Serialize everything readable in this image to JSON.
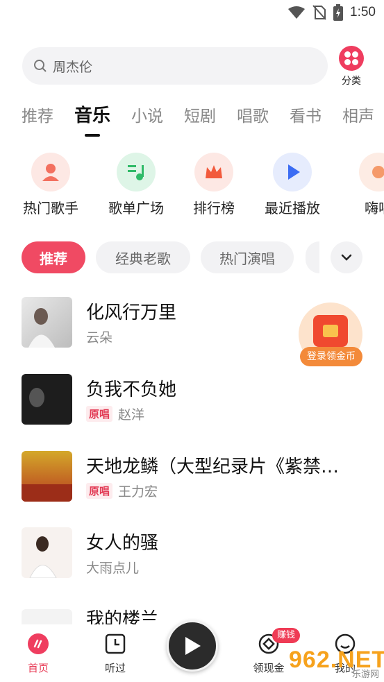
{
  "status_bar": {
    "time": "1:50",
    "icons": [
      "wifi-icon",
      "no-sim-icon",
      "battery-charging-icon"
    ]
  },
  "search": {
    "text": "周杰伦",
    "icon": "search-icon"
  },
  "category_button": {
    "label": "分类",
    "icon": "grid-dots-icon",
    "color": "#ef3d5f"
  },
  "tabs": [
    {
      "label": "推荐"
    },
    {
      "label": "音乐",
      "active": true
    },
    {
      "label": "小说"
    },
    {
      "label": "短剧"
    },
    {
      "label": "唱歌"
    },
    {
      "label": "看书"
    },
    {
      "label": "相声"
    }
  ],
  "quick_entries": [
    {
      "label": "热门歌手",
      "icon": "singer-icon"
    },
    {
      "label": "歌单广场",
      "icon": "playlist-icon"
    },
    {
      "label": "排行榜",
      "icon": "crown-icon"
    },
    {
      "label": "最近播放",
      "icon": "play-icon"
    },
    {
      "label": "嗨唱",
      "icon": "mic-icon"
    }
  ],
  "filter_chips": [
    {
      "label": "推荐",
      "active": true
    },
    {
      "label": "经典老歌"
    },
    {
      "label": "热门演唱"
    }
  ],
  "songs": [
    {
      "title": "化风行万里",
      "artist": "云朵",
      "original": ""
    },
    {
      "title": "负我不负她",
      "artist": "赵洋",
      "original": "原唱"
    },
    {
      "title": "天地龙鳞（大型纪录片《紫禁…",
      "artist": "王力宏",
      "original": "原唱"
    },
    {
      "title": "女人的骚",
      "artist": "大雨点儿",
      "original": ""
    },
    {
      "title": "我的楼兰",
      "artist": "",
      "original": ""
    }
  ],
  "coin_float": {
    "label": "登录领金币"
  },
  "bottom_nav": {
    "home": "首页",
    "history": "听过",
    "earn": "领现金",
    "earn_badge": "赚钱",
    "me": "我的"
  },
  "watermark": {
    "main": "962.NET",
    "sub": "乐游网"
  },
  "colors": {
    "accent": "#f04a63",
    "gray_bg": "#f2f2f4"
  }
}
